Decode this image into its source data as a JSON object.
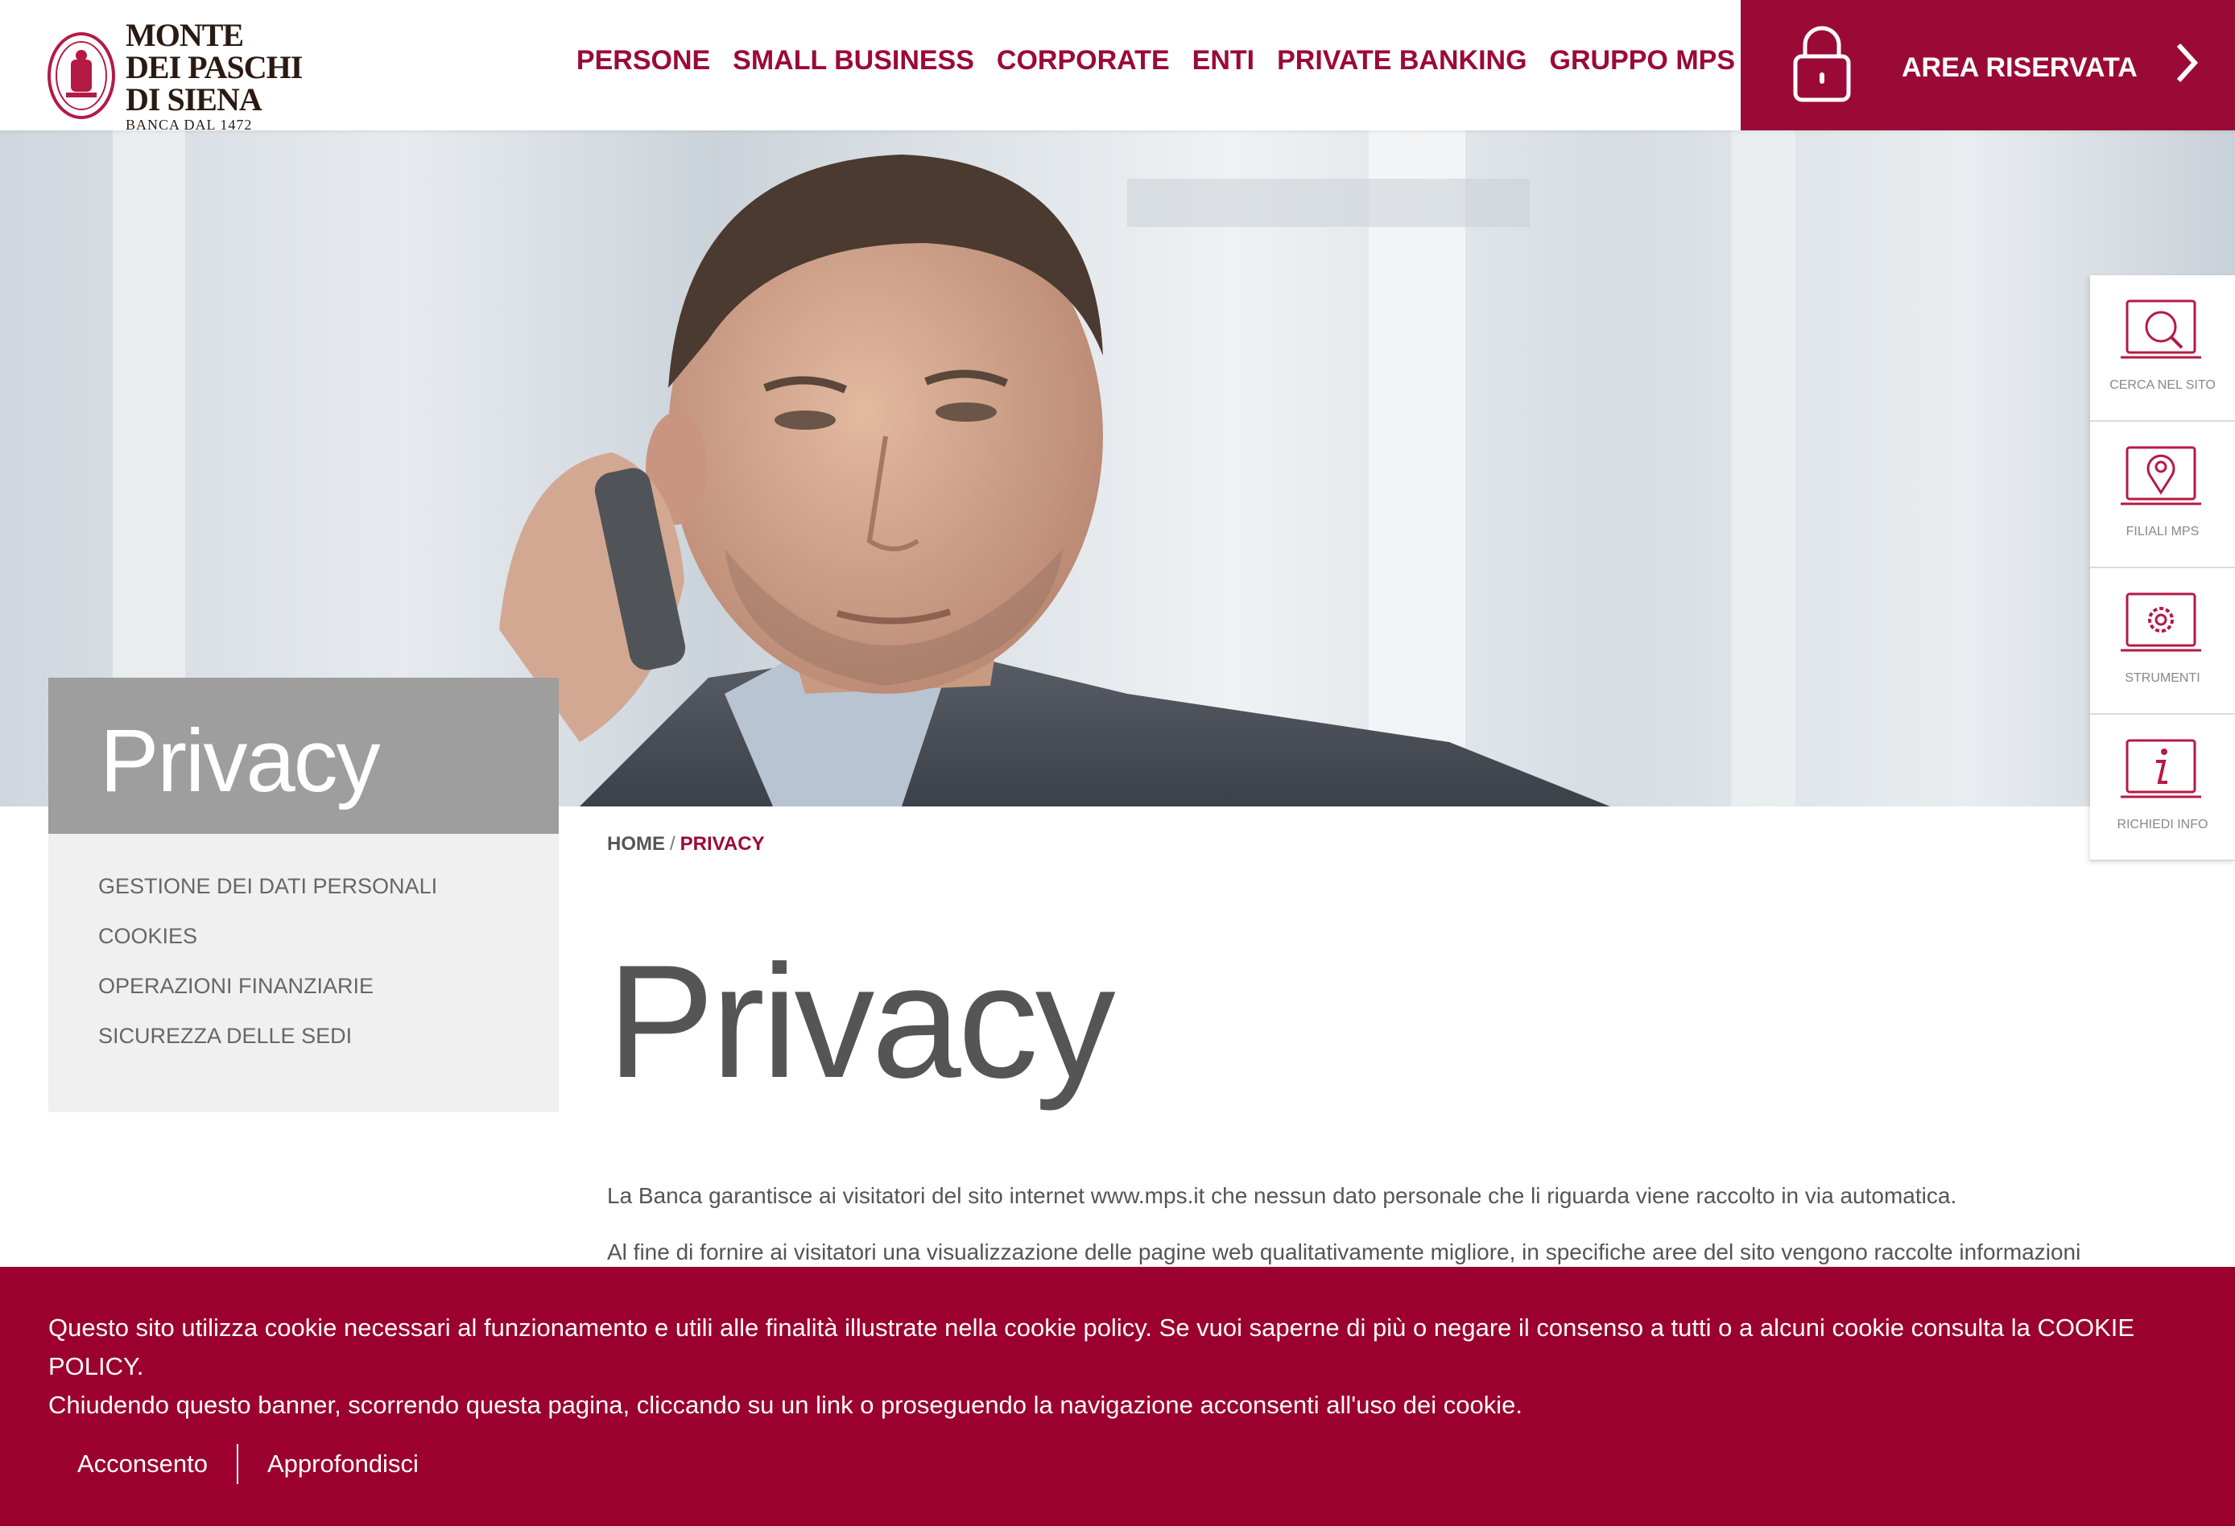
{
  "brand": {
    "logo_lines": [
      "MONTE",
      "DEI PASCHI",
      "DI SIENA"
    ],
    "logo_sub": "BANCA DAL 1472",
    "accent_color": "#9b0a37"
  },
  "nav": {
    "items": [
      "PERSONE",
      "SMALL BUSINESS",
      "CORPORATE",
      "ENTI",
      "PRIVATE BANKING",
      "GRUPPO MPS"
    ],
    "area_label": "AREA RISERVATA",
    "area_icon": "lock-icon"
  },
  "sidebar": {
    "title": "Privacy",
    "items": [
      "GESTIONE DEI DATI PERSONALI",
      "COOKIES",
      "OPERAZIONI FINANZIARIE",
      "SICUREZZA DELLE SEDI"
    ]
  },
  "breadcrumb": {
    "home": "HOME",
    "separator": "/",
    "current": "PRIVACY"
  },
  "content": {
    "title": "Privacy",
    "paragraph1": "La Banca garantisce ai visitatori del sito internet www.mps.it che nessun dato personale che li riguarda viene raccolto in via automatica.",
    "paragraph2": "Al fine di fornire ai visitatori una visualizzazione delle pagine web qualitativamente migliore, in specifiche aree del sito vengono raccolte informazioni"
  },
  "tools": [
    {
      "label": "CERCA NEL SITO",
      "icon": "search-icon"
    },
    {
      "label": "FILIALI MPS",
      "icon": "map-pin-icon"
    },
    {
      "label": "STRUMENTI",
      "icon": "gear-icon"
    },
    {
      "label": "RICHIEDI INFO",
      "icon": "info-icon"
    }
  ],
  "cookie": {
    "line1": "Questo sito utilizza cookie necessari al funzionamento e utili alle finalità illustrate nella cookie policy. Se vuoi saperne di più o negare il consenso a tutti o a alcuni cookie consulta la COOKIE POLICY.",
    "line2": "Chiudendo questo banner, scorrendo questa pagina, cliccando su un link o proseguendo la navigazione acconsenti all'uso dei cookie.",
    "accept": "Acconsento",
    "more": "Approfondisci"
  }
}
